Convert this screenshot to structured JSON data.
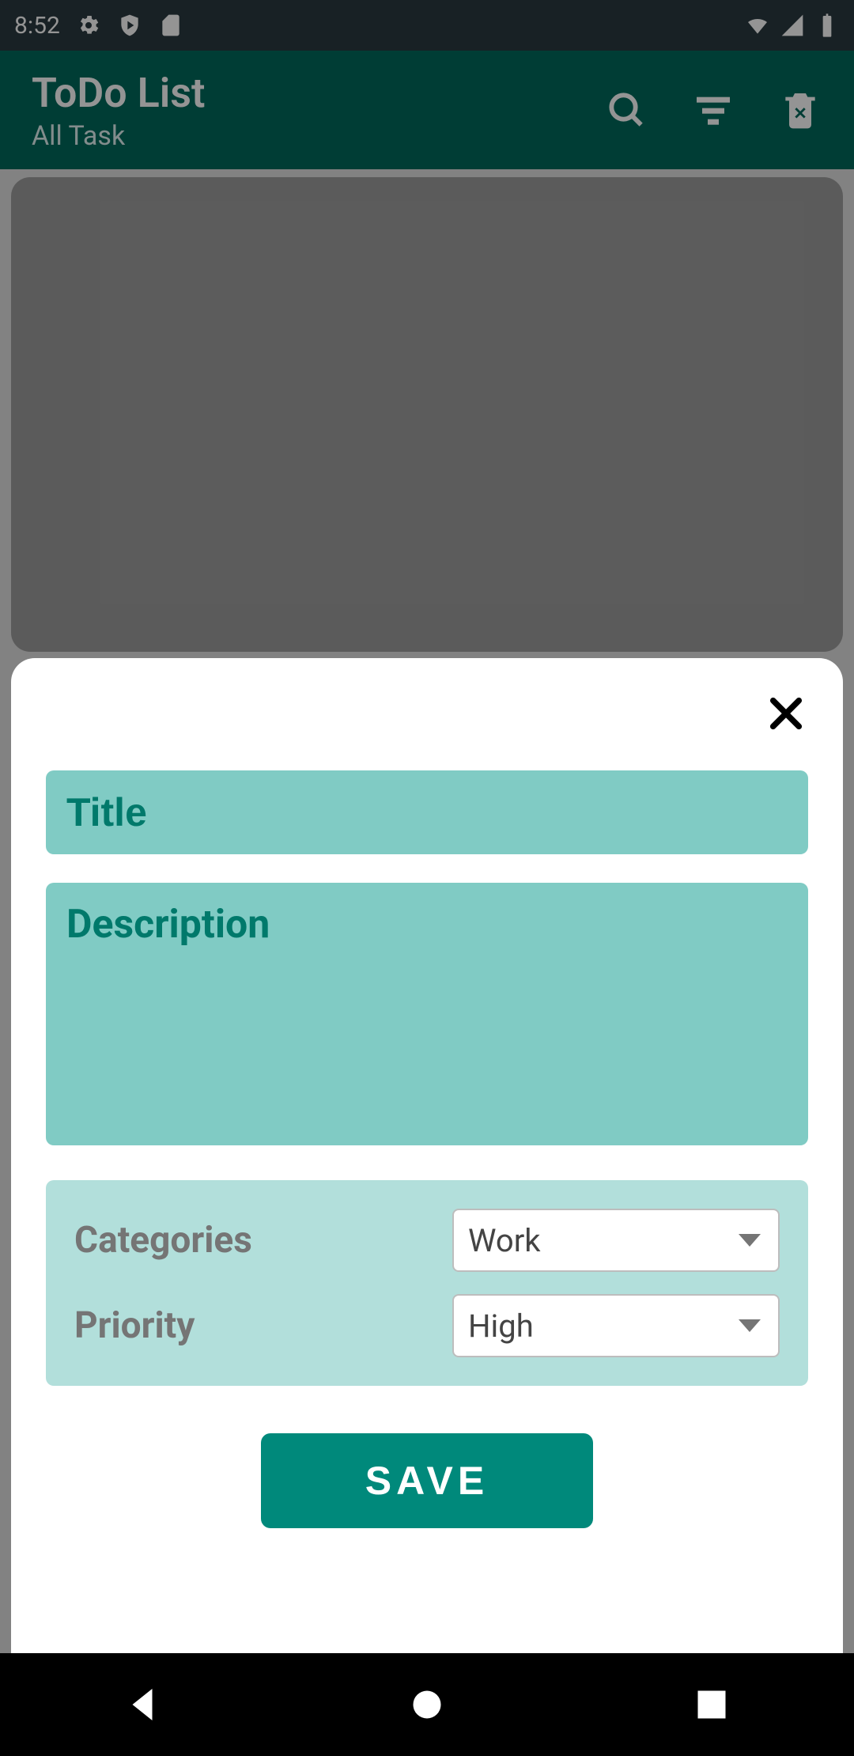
{
  "status_bar": {
    "time": "8:52"
  },
  "app_bar": {
    "title": "ToDo List",
    "subtitle": "All Task"
  },
  "sheet": {
    "title_placeholder": "Title",
    "title_value": "",
    "description_placeholder": "Description",
    "description_value": "",
    "categories": {
      "label": "Categories",
      "selected": "Work"
    },
    "priority": {
      "label": "Priority",
      "selected": "High"
    },
    "save_label": "SAVE"
  }
}
